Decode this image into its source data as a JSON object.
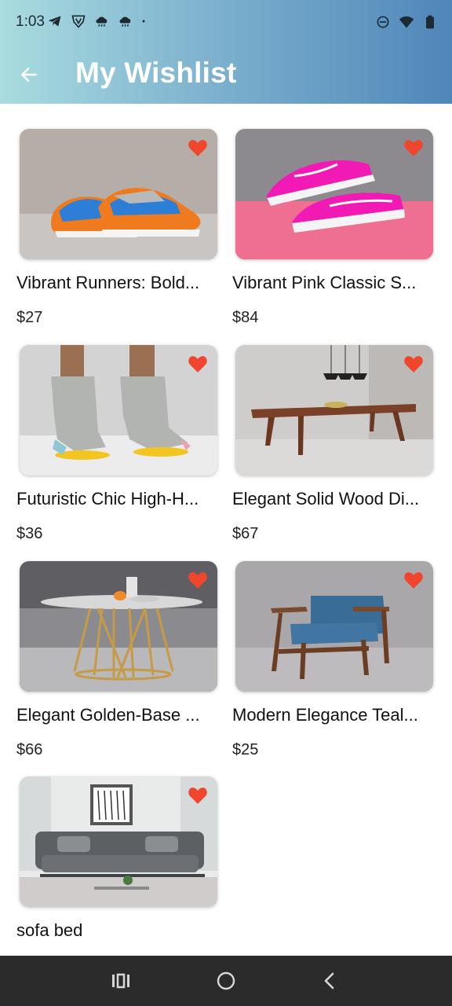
{
  "status_bar": {
    "time": "1:03",
    "left_icons": [
      "telegram-icon",
      "vpn-shield-icon",
      "rain-cloud-icon",
      "rain-cloud-icon",
      "dot-icon"
    ],
    "right_icons": [
      "do-not-disturb-icon",
      "wifi-icon",
      "battery-icon"
    ]
  },
  "header": {
    "title": "My Wishlist",
    "back_icon": "arrow-left-icon",
    "gradient": [
      "#a9dcdf",
      "#4f86b9"
    ]
  },
  "products": [
    {
      "name": "Vibrant Runners: Bold...",
      "price": "$27",
      "image": "orange-blue-sneakers"
    },
    {
      "name": "Vibrant Pink Classic S...",
      "price": "$84",
      "image": "pink-sneakers"
    },
    {
      "name": "Futuristic Chic High-H...",
      "price": "$36",
      "image": "gray-high-heel-boots"
    },
    {
      "name": "Elegant Solid Wood Di...",
      "price": "$67",
      "image": "wood-dining-table"
    },
    {
      "name": "Elegant Golden-Base ...",
      "price": "$66",
      "image": "golden-base-table"
    },
    {
      "name": "Modern Elegance Teal...",
      "price": "$25",
      "image": "teal-armchair"
    },
    {
      "name": "sofa bed",
      "price": "",
      "image": "gray-sofa-bed"
    }
  ],
  "heart_color": "#f0462d",
  "nav_bar": {
    "icons": [
      "recent-apps-icon",
      "home-icon",
      "back-icon"
    ]
  }
}
